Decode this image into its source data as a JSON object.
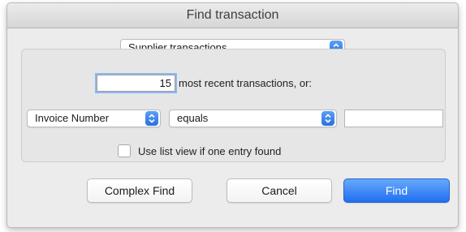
{
  "dialog": {
    "title": "Find transaction"
  },
  "transaction_type": {
    "selected": "Supplier transactions"
  },
  "recent": {
    "count": "15",
    "suffix": "most recent transactions, or:"
  },
  "criteria": {
    "field": "Invoice Number",
    "operator": "equals",
    "value": ""
  },
  "options": {
    "list_view_label": "Use list view if one entry found",
    "list_view_checked": false
  },
  "buttons": {
    "complex_find": "Complex Find",
    "cancel": "Cancel",
    "find": "Find"
  },
  "colors": {
    "accent": "#2b6fe0",
    "focus_ring": "#8fb8f0"
  },
  "icons": {
    "popup_stepper": "up-down-chevron-icon"
  }
}
